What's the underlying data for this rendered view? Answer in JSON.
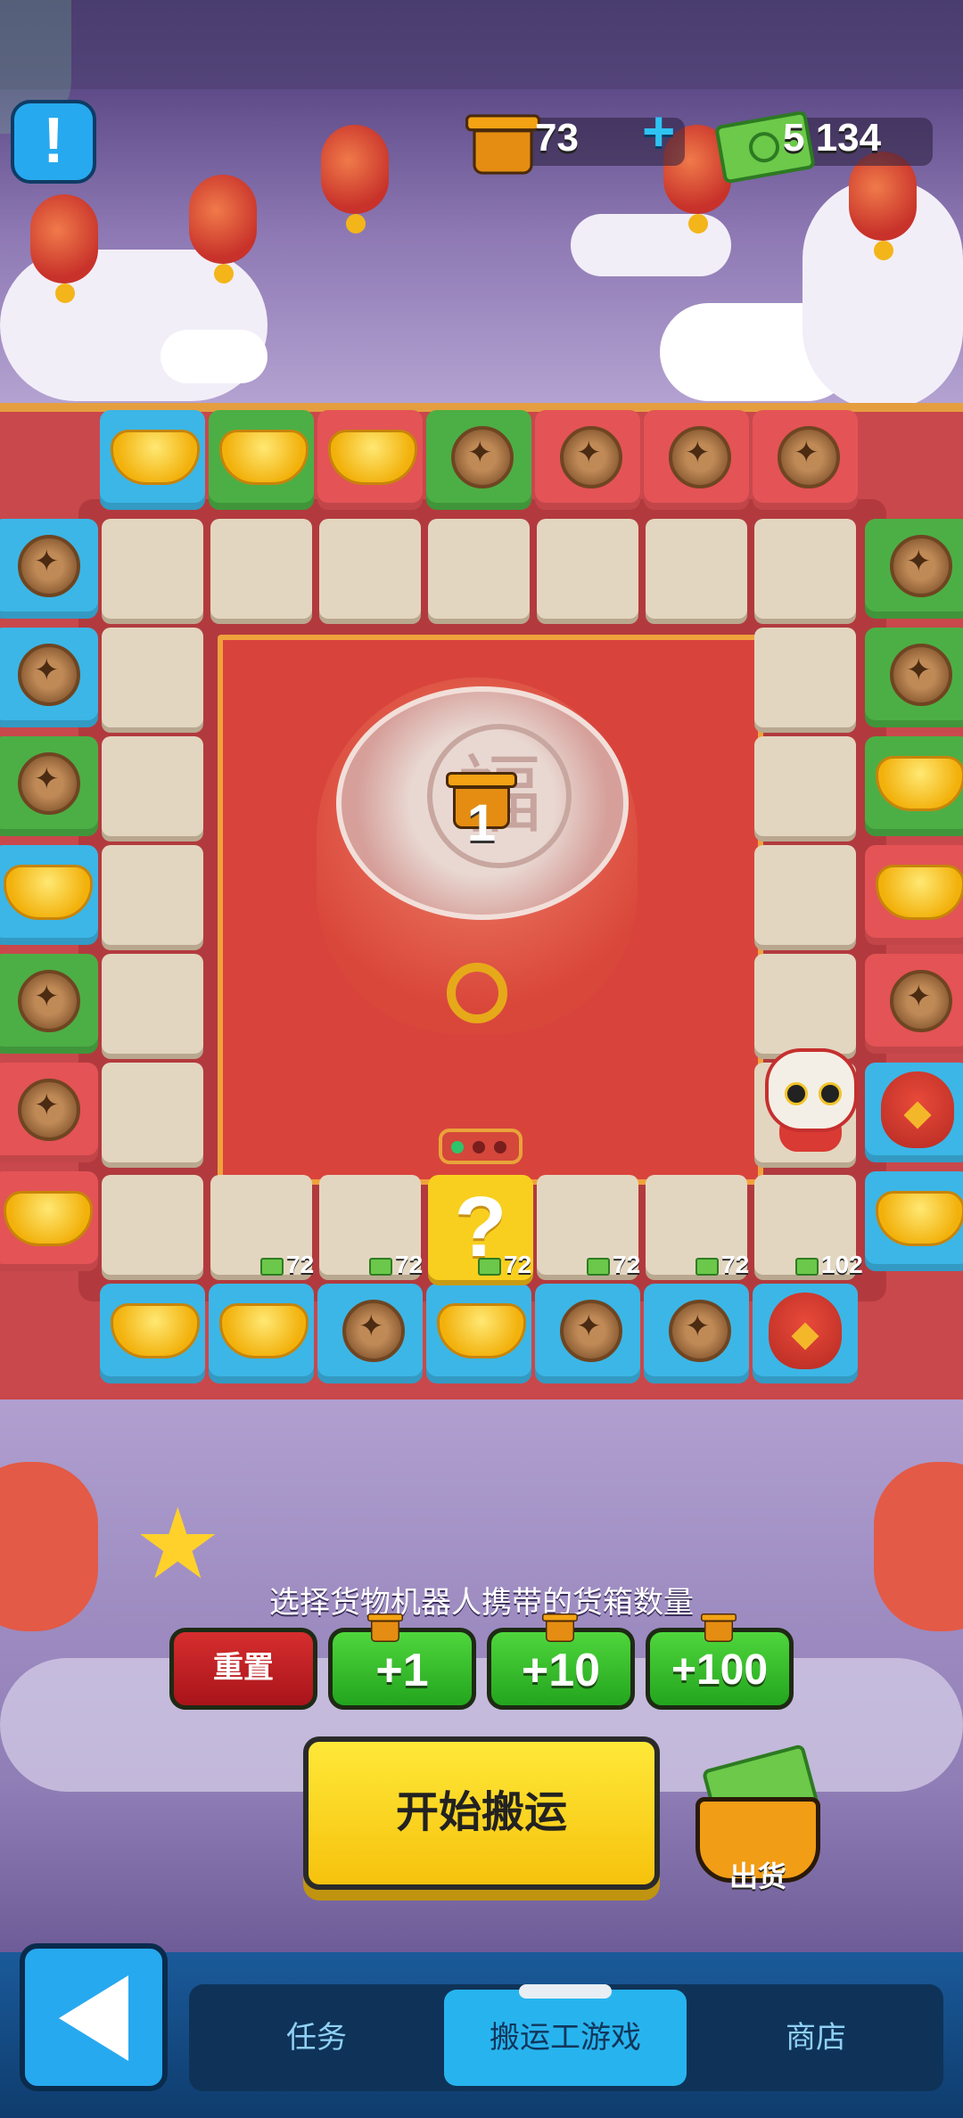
{
  "hud": {
    "crate_count": "73",
    "cash_count": "5 134"
  },
  "board": {
    "drum_count": "1",
    "question_mark": "?",
    "prices": [
      "72",
      "72",
      "72",
      "72",
      "72",
      "102"
    ],
    "top_row": [
      "ingot",
      "ingot",
      "ingot",
      "coin",
      "coin",
      "coin",
      "coin"
    ],
    "top_row_colors": [
      "blue",
      "green",
      "red",
      "green",
      "red",
      "red",
      "red"
    ],
    "left_col": [
      "coin",
      "coin",
      "coin",
      "ingot",
      "coin",
      "coin",
      "ingot"
    ],
    "left_col_colors": [
      "blue",
      "blue",
      "green",
      "blue",
      "green",
      "red",
      "red"
    ],
    "right_col": [
      "coin",
      "coin",
      "ingot",
      "ingot",
      "coin",
      "bag",
      "ingot"
    ],
    "right_col_colors": [
      "green",
      "green",
      "green",
      "red",
      "red",
      "blue",
      "blue"
    ],
    "bottom_row": [
      "ingot",
      "ingot",
      "coin",
      "ingot",
      "coin",
      "coin",
      "bag"
    ],
    "bottom_row_colors": [
      "blue",
      "blue",
      "blue",
      "blue",
      "blue",
      "blue",
      "blue"
    ]
  },
  "controls": {
    "instruction": "选择货物机器人携带的货箱数量",
    "reset_label": "重置",
    "plus1_label": "+1",
    "plus10_label": "+10",
    "plus100_label": "+100",
    "start_label": "开始搬运",
    "ship_label": "出货"
  },
  "nav": {
    "tabs": [
      {
        "label": "任务"
      },
      {
        "label": "搬运工游戏"
      },
      {
        "label": "商店"
      }
    ]
  },
  "colors": {
    "tile_blue": "#3cb6e6",
    "tile_green": "#4caf45",
    "tile_red": "#e45356",
    "button_green": "#2fb52a",
    "button_yellow": "#f9d51f",
    "active_tab": "#27b4ee"
  }
}
